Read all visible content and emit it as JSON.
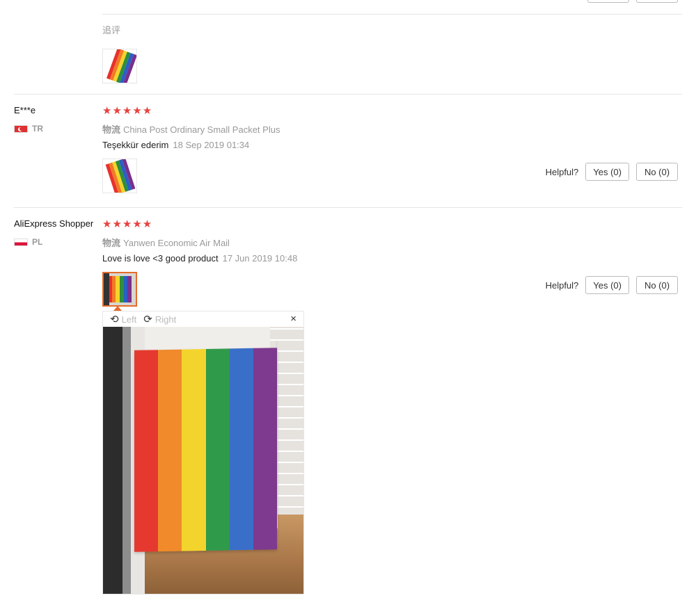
{
  "append_review": {
    "label": "追评"
  },
  "reviews": [
    {
      "name": "E***e",
      "country": "TR",
      "stars": "★★★★★",
      "logistics_label": "物流",
      "logistics": "China Post Ordinary Small Packet Plus",
      "text": "Teşekkür ederim",
      "date": "18 Sep 2019 01:34",
      "helpful_label": "Helpful?",
      "yes_label": "Yes (0)",
      "no_label": "No (0)"
    },
    {
      "name": "AliExpress Shopper",
      "country": "PL",
      "stars": "★★★★★",
      "logistics_label": "物流",
      "logistics": "Yanwen Economic Air Mail",
      "text": "Love is love <3 good product",
      "date": "17 Jun 2019 10:48",
      "helpful_label": "Helpful?",
      "yes_label": "Yes (0)",
      "no_label": "No (0)"
    }
  ],
  "viewer": {
    "rotate_left_label": "Left",
    "rotate_right_label": "Right",
    "close_glyph": "×"
  },
  "colors": {
    "star": "#e8423f",
    "active_thumb_border": "#e56b2b",
    "rainbow": [
      "#e8312b",
      "#f07a26",
      "#f6d32a",
      "#2e8f3e",
      "#2b5fc4",
      "#7a2f8c"
    ]
  }
}
